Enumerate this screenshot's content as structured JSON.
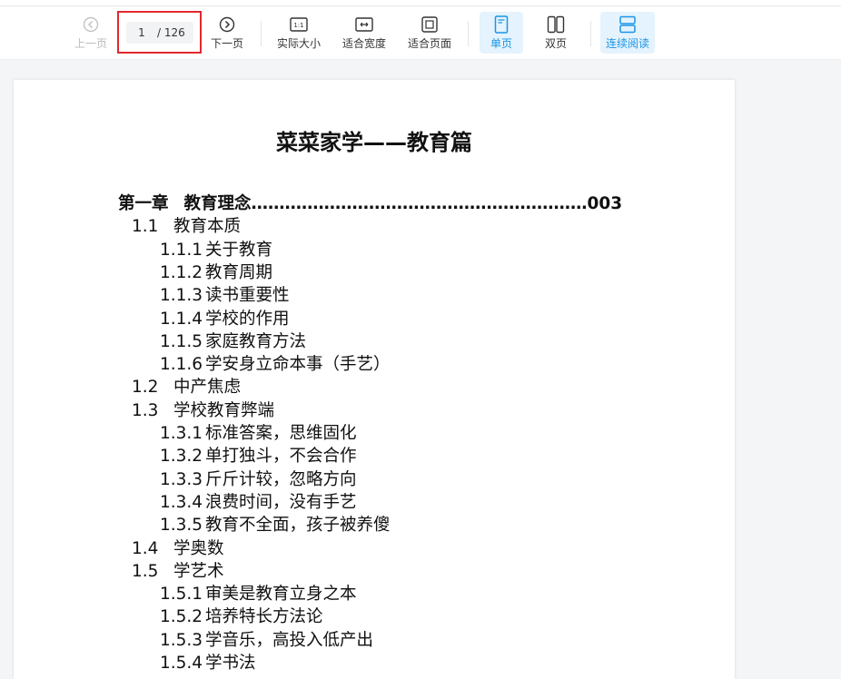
{
  "toolbar": {
    "prev_label": "上一页",
    "next_label": "下一页",
    "page_current": "1",
    "page_total": "/ 126",
    "actual_size_label": "实际大小",
    "fit_width_label": "适合宽度",
    "fit_page_label": "适合页面",
    "single_page_label": "单页",
    "double_page_label": "双页",
    "continuous_label": "连续阅读"
  },
  "document": {
    "title": "菜菜家学——教育篇",
    "toc": [
      {
        "level": 1,
        "num": "第一章",
        "text": "教育理念……………………………………………………003"
      },
      {
        "level": 2,
        "num": "1.1",
        "text": "教育本质"
      },
      {
        "level": 3,
        "num": "1.1.1",
        "text": "关于教育"
      },
      {
        "level": 3,
        "num": "1.1.2",
        "text": "教育周期"
      },
      {
        "level": 3,
        "num": "1.1.3",
        "text": "读书重要性"
      },
      {
        "level": 3,
        "num": "1.1.4",
        "text": "学校的作用"
      },
      {
        "level": 3,
        "num": "1.1.5",
        "text": "家庭教育方法"
      },
      {
        "level": 3,
        "num": "1.1.6",
        "text": "学安身立命本事（手艺）"
      },
      {
        "level": 2,
        "num": "1.2",
        "text": "中产焦虑"
      },
      {
        "level": 2,
        "num": "1.3",
        "text": "学校教育弊端"
      },
      {
        "level": 3,
        "num": "1.3.1",
        "text": "标准答案，思维固化"
      },
      {
        "level": 3,
        "num": "1.3.2",
        "text": "单打独斗，不会合作"
      },
      {
        "level": 3,
        "num": "1.3.3",
        "text": "斤斤计较，忽略方向"
      },
      {
        "level": 3,
        "num": "1.3.4",
        "text": "浪费时间，没有手艺"
      },
      {
        "level": 3,
        "num": "1.3.5",
        "text": "教育不全面，孩子被养傻"
      },
      {
        "level": 2,
        "num": "1.4",
        "text": "学奥数"
      },
      {
        "level": 2,
        "num": "1.5",
        "text": "学艺术"
      },
      {
        "level": 3,
        "num": "1.5.1",
        "text": "审美是教育立身之本"
      },
      {
        "level": 3,
        "num": "1.5.2",
        "text": "培养特长方法论"
      },
      {
        "level": 3,
        "num": "1.5.3",
        "text": "学音乐，高投入低产出"
      },
      {
        "level": 3,
        "num": "1.5.4",
        "text": "学书法"
      }
    ]
  },
  "colors": {
    "accent": "#1a94e6",
    "active_bg": "#e4f3fd",
    "highlight_border": "#e3282b"
  }
}
